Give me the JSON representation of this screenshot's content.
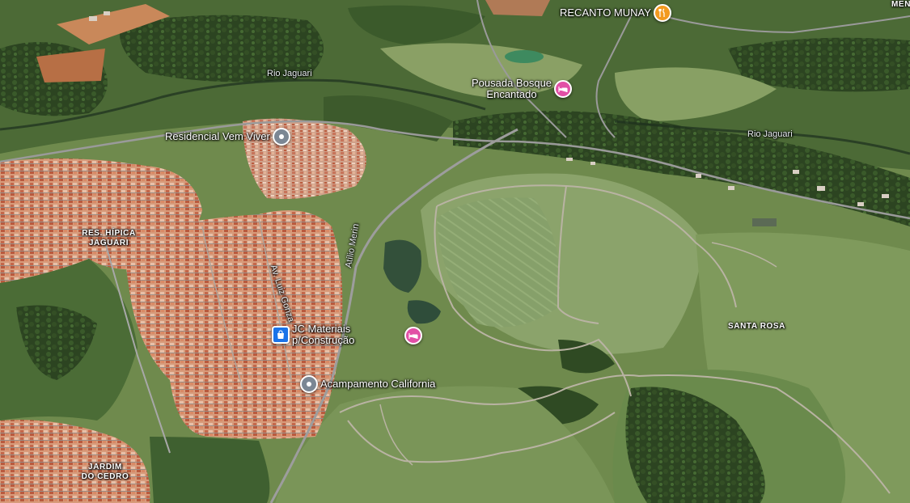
{
  "map": {
    "places": {
      "recanto": {
        "label": "RECANTO MUNAY",
        "icon": "restaurant-icon"
      },
      "pousada": {
        "label": "Pousada Bosque\nEncantado",
        "icon": "lodging-icon"
      },
      "residencial": {
        "label": "Residencial Vem Viver",
        "icon": "place-pin-icon"
      },
      "jc": {
        "label": "JC Materiais\np/Construção",
        "icon": "shopping-bag-icon"
      },
      "acampamento": {
        "label": "Acampamento California",
        "icon": "place-pin-icon"
      },
      "lodging2": {
        "label": "",
        "icon": "lodging-icon"
      }
    },
    "areas": {
      "hipica": "RES. HÍPICA\nJAGUARI",
      "santa_rosa": "SANTA ROSA",
      "jardim": "JARDIM\nDO CEDRO",
      "edge": "MEN"
    },
    "rivers": {
      "r1": "Rio Jaguari",
      "r2": "Rio Jaguari"
    },
    "roads": {
      "av": "Av. Luiz Gonza",
      "atilio": "Atílio Merin"
    }
  },
  "colors": {
    "lodging": "#e24fa6",
    "restaurant": "#f29a1f",
    "shop": "#1a73e8",
    "generic_pin": "#7b8794",
    "pasture": "#7f9a5a",
    "forest": "#2f4a23",
    "urban": "#c98a6a"
  }
}
